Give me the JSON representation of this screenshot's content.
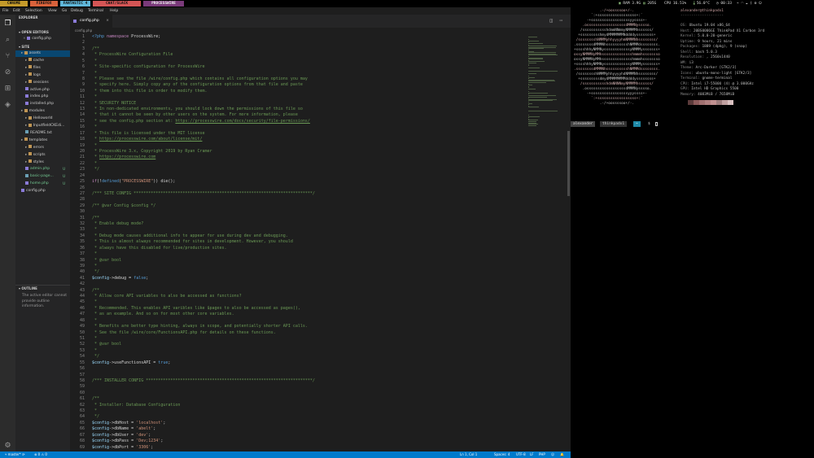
{
  "topbar": {
    "workspaces": [
      {
        "label": "CHROME",
        "color": "#c49a2a"
      },
      {
        "label": "FIREFOX",
        "color": "#d9623b"
      },
      {
        "label": "FANTASTIC 4",
        "color": "#5fb6d9"
      },
      {
        "label": "CHAT/SLACK",
        "color": "#d45555"
      },
      {
        "label": "PROCESSWIRE",
        "color": "#7a3a7a"
      }
    ],
    "ram": "RAM 3.9G",
    "cpu": "CPU 16.51%",
    "temp": "56.0°C",
    "time": "00:33",
    "disk": "205G",
    "accent_green": "#8ec07c"
  },
  "vscode": {
    "menu": [
      "File",
      "Edit",
      "Selection",
      "View",
      "Go",
      "Debug",
      "Terminal",
      "Help"
    ],
    "explorer_title": "EXPLORER",
    "open_editors_title": "OPEN EDITORS",
    "open_editor_file": "config.php",
    "site_title": "SITE",
    "tree": [
      {
        "label": "assets",
        "sel": true,
        "mark": "",
        "indent": 1
      },
      {
        "label": "cache",
        "mark": "",
        "indent": 2
      },
      {
        "label": "files",
        "mark": "",
        "indent": 2
      },
      {
        "label": "logs",
        "mark": "",
        "indent": 2
      },
      {
        "label": "sessions",
        "mark": "",
        "indent": 2
      },
      {
        "label": "active.php",
        "mark": "",
        "indent": 2
      },
      {
        "label": "index.php",
        "mark": "",
        "indent": 2
      },
      {
        "label": "installed.php",
        "mark": "",
        "indent": 2
      },
      {
        "label": "modules",
        "mark": "",
        "indent": 1
      },
      {
        "label": "Helloworld",
        "mark": "",
        "indent": 2
      },
      {
        "label": "InputfieldCKEdi...",
        "mark": "",
        "indent": 2
      },
      {
        "label": "README.txt",
        "mark": "",
        "indent": 2
      },
      {
        "label": "templates",
        "mark": "",
        "indent": 1
      },
      {
        "label": "errors",
        "mark": "",
        "indent": 2
      },
      {
        "label": "scripts",
        "mark": "",
        "indent": 2
      },
      {
        "label": "styles",
        "mark": "",
        "indent": 2
      },
      {
        "label": "admin.php",
        "mark": "U",
        "indent": 2
      },
      {
        "label": "basic-page...",
        "mark": "U",
        "indent": 2
      },
      {
        "label": "home.php",
        "mark": "U",
        "indent": 2
      },
      {
        "label": "config.php",
        "mark": "",
        "indent": 1
      }
    ],
    "outline_title": "OUTLINE",
    "outline_msg": "The active editor cannot provide outline information.",
    "tab_label": "config.php",
    "breadcrumb": "config.php",
    "code_lines": [
      {
        "n": "1",
        "parts": [
          [
            "tag",
            "<?php "
          ],
          [
            "kw",
            "namespace"
          ],
          [
            "plain",
            " ProcessWire;"
          ]
        ]
      },
      {
        "n": "2",
        "parts": []
      },
      {
        "n": "3",
        "parts": [
          [
            "comment",
            "/**"
          ]
        ]
      },
      {
        "n": "4",
        "parts": [
          [
            "comment",
            " * ProcessWire Configuration File"
          ]
        ]
      },
      {
        "n": "5",
        "parts": [
          [
            "comment",
            " *"
          ]
        ]
      },
      {
        "n": "6",
        "parts": [
          [
            "comment",
            " * Site-specific configuration for ProcessWire"
          ]
        ]
      },
      {
        "n": "7",
        "parts": [
          [
            "comment",
            " *"
          ]
        ]
      },
      {
        "n": "8",
        "parts": [
          [
            "comment",
            " * Please see the file /wire/config.php which contains all configuration options you may"
          ]
        ]
      },
      {
        "n": "9",
        "parts": [
          [
            "comment",
            " * specify here. Simply copy any of the configuration options from that file and paste"
          ]
        ]
      },
      {
        "n": "10",
        "parts": [
          [
            "comment",
            " * them into this file in order to modify them."
          ]
        ]
      },
      {
        "n": "11",
        "parts": [
          [
            "comment",
            " *"
          ]
        ]
      },
      {
        "n": "12",
        "parts": [
          [
            "comment",
            " * SECURITY NOTICE"
          ]
        ]
      },
      {
        "n": "13",
        "parts": [
          [
            "comment",
            " * In non-dedicated environments, you should lock down the permissions of this file so"
          ]
        ]
      },
      {
        "n": "14",
        "parts": [
          [
            "comment",
            " * that it cannot be seen by other users on the system. For more information, please"
          ]
        ]
      },
      {
        "n": "15",
        "parts": [
          [
            "comment",
            " * see the config.php section at: "
          ],
          [
            "link",
            "https://processwire.com/docs/security/file-permissions/"
          ]
        ]
      },
      {
        "n": "16",
        "parts": [
          [
            "comment",
            " *"
          ]
        ]
      },
      {
        "n": "17",
        "parts": [
          [
            "comment",
            " * This file is licensed under the MIT license"
          ]
        ]
      },
      {
        "n": "18",
        "parts": [
          [
            "comment",
            " * "
          ],
          [
            "link",
            "https://processwire.com/about/license/mit/"
          ]
        ]
      },
      {
        "n": "19",
        "parts": [
          [
            "comment",
            " *"
          ]
        ]
      },
      {
        "n": "20",
        "parts": [
          [
            "comment",
            " * ProcessWire 3.x, Copyright 2019 by Ryan Cramer"
          ]
        ]
      },
      {
        "n": "21",
        "parts": [
          [
            "comment",
            " * "
          ],
          [
            "link",
            "https://processwire.com"
          ]
        ]
      },
      {
        "n": "22",
        "parts": [
          [
            "comment",
            " *"
          ]
        ]
      },
      {
        "n": "23",
        "parts": [
          [
            "comment",
            " */"
          ]
        ]
      },
      {
        "n": "24",
        "parts": []
      },
      {
        "n": "25",
        "parts": [
          [
            "kw",
            "if"
          ],
          [
            "plain",
            "(!"
          ],
          [
            "tag",
            "defined"
          ],
          [
            "plain",
            "("
          ],
          [
            "str",
            "\"PROCESSWIRE\""
          ],
          [
            "plain",
            ")) die();"
          ]
        ]
      },
      {
        "n": "26",
        "parts": []
      },
      {
        "n": "27",
        "parts": [
          [
            "comment",
            "/*** SITE CONFIG *************************************************************************/"
          ]
        ]
      },
      {
        "n": "28",
        "parts": []
      },
      {
        "n": "29",
        "parts": [
          [
            "comment",
            "/** @var Config $config */"
          ]
        ]
      },
      {
        "n": "30",
        "parts": []
      },
      {
        "n": "31",
        "parts": [
          [
            "comment",
            "/**"
          ]
        ]
      },
      {
        "n": "32",
        "parts": [
          [
            "comment",
            " * Enable debug mode?"
          ]
        ]
      },
      {
        "n": "33",
        "parts": [
          [
            "comment",
            " *"
          ]
        ]
      },
      {
        "n": "34",
        "parts": [
          [
            "comment",
            " * Debug mode causes additional info to appear for use during dev and debugging."
          ]
        ]
      },
      {
        "n": "35",
        "parts": [
          [
            "comment",
            " * This is almost always recommended for sites in development. However, you should"
          ]
        ]
      },
      {
        "n": "36",
        "parts": [
          [
            "comment",
            " * always have this disabled for live/production sites."
          ]
        ]
      },
      {
        "n": "37",
        "parts": [
          [
            "comment",
            " *"
          ]
        ]
      },
      {
        "n": "38",
        "parts": [
          [
            "comment",
            " * @var bool"
          ]
        ]
      },
      {
        "n": "39",
        "parts": [
          [
            "comment",
            " *"
          ]
        ]
      },
      {
        "n": "40",
        "parts": [
          [
            "comment",
            " */"
          ]
        ]
      },
      {
        "n": "41",
        "parts": [
          [
            "var",
            "$config"
          ],
          [
            "plain",
            "->debug = "
          ],
          [
            "tag",
            "false"
          ],
          [
            "plain",
            ";"
          ]
        ]
      },
      {
        "n": "42",
        "parts": []
      },
      {
        "n": "43",
        "parts": [
          [
            "comment",
            "/**"
          ]
        ]
      },
      {
        "n": "44",
        "parts": [
          [
            "comment",
            " * Allow core API variables to also be accessed as functions?"
          ]
        ]
      },
      {
        "n": "45",
        "parts": [
          [
            "comment",
            " *"
          ]
        ]
      },
      {
        "n": "46",
        "parts": [
          [
            "comment",
            " * Recommended. This enables API varibles like $pages to also be accessed as pages(),"
          ]
        ]
      },
      {
        "n": "47",
        "parts": [
          [
            "comment",
            " * as an example. And so on for most other core variables."
          ]
        ]
      },
      {
        "n": "48",
        "parts": [
          [
            "comment",
            " *"
          ]
        ]
      },
      {
        "n": "49",
        "parts": [
          [
            "comment",
            " * Benefits are better type hinting, always in scope, and potentially shorter API calls."
          ]
        ]
      },
      {
        "n": "50",
        "parts": [
          [
            "comment",
            " * See the file /wire/core/FunctionsAPI.php for details on these functions."
          ]
        ]
      },
      {
        "n": "51",
        "parts": [
          [
            "comment",
            " *"
          ]
        ]
      },
      {
        "n": "52",
        "parts": [
          [
            "comment",
            " * @var bool"
          ]
        ]
      },
      {
        "n": "53",
        "parts": [
          [
            "comment",
            " *"
          ]
        ]
      },
      {
        "n": "54",
        "parts": [
          [
            "comment",
            " */"
          ]
        ]
      },
      {
        "n": "55",
        "parts": [
          [
            "var",
            "$config"
          ],
          [
            "plain",
            "->useFunctionsAPI = "
          ],
          [
            "tag",
            "true"
          ],
          [
            "plain",
            ";"
          ]
        ]
      },
      {
        "n": "56",
        "parts": []
      },
      {
        "n": "57",
        "parts": []
      },
      {
        "n": "58",
        "parts": [
          [
            "comment",
            "/*** INSTALLER CONFIG ********************************************************************/"
          ]
        ]
      },
      {
        "n": "59",
        "parts": []
      },
      {
        "n": "60",
        "parts": []
      },
      {
        "n": "61",
        "parts": [
          [
            "comment",
            "/**"
          ]
        ]
      },
      {
        "n": "62",
        "parts": [
          [
            "comment",
            " * Installer: Database Configuration"
          ]
        ]
      },
      {
        "n": "63",
        "parts": [
          [
            "comment",
            " *"
          ]
        ]
      },
      {
        "n": "64",
        "parts": [
          [
            "comment",
            " */"
          ]
        ]
      },
      {
        "n": "65",
        "parts": [
          [
            "var",
            "$config"
          ],
          [
            "plain",
            "->dbHost = "
          ],
          [
            "str",
            "'localhost'"
          ],
          [
            "plain",
            ";"
          ]
        ]
      },
      {
        "n": "66",
        "parts": [
          [
            "var",
            "$config"
          ],
          [
            "plain",
            "->dbName = "
          ],
          [
            "str",
            "'abelt'"
          ],
          [
            "plain",
            ";"
          ]
        ]
      },
      {
        "n": "67",
        "parts": [
          [
            "var",
            "$config"
          ],
          [
            "plain",
            "->dbUser = "
          ],
          [
            "str",
            "'dev'"
          ],
          [
            "plain",
            ";"
          ]
        ]
      },
      {
        "n": "68",
        "parts": [
          [
            "var",
            "$config"
          ],
          [
            "plain",
            "->dbPass = "
          ],
          [
            "str",
            "'Dev;1234'"
          ],
          [
            "plain",
            ";"
          ]
        ]
      },
      {
        "n": "69",
        "parts": [
          [
            "var",
            "$config"
          ],
          [
            "plain",
            "->dbPort = "
          ],
          [
            "str",
            "'3306'"
          ],
          [
            "plain",
            ";"
          ]
        ]
      }
    ],
    "status": {
      "branch": "master*",
      "sync": "⟳",
      "errors": "0",
      "warnings": "0",
      "position": "Ln 1, Col 1",
      "spaces": "Spaces: 4",
      "encoding": "UTF-8",
      "eol": "LF",
      "language": "PHP"
    }
  },
  "terminal": {
    "ascii_art": [
      "            .-/+oossssoo+/-.",
      "        `:+ssssssssssssssssss+:`",
      "      -+ssssssssssssssssssyyssss+-",
      "    .ossssssssssssssssssdMMMNysssso.",
      "   /ssssssssssshdmmNNmmyNMMMMhssssss/",
      "  +ssssssssshmydMMMMMMMNddddyssssssss+",
      " /sssssssshNMMMyhhyyyyhmNMMMNhssssssss/",
      ".ssssssssdMMMNhsssssssssshNMMMdssssssss.",
      "+sssshhhyNMMNyssssssssssssyNMMMysssssss+",
      "ossyNMMMNyMMhsssssssssssssshmmmhssssssso",
      "ossyNMMMNyMMhsssssssssssssshmmmhssssssso",
      "+sssshhhyNMMNyssssssssssssyNMMMysssssss+",
      ".ssssssssdMMMNhsssssssssshNMMMdssssssss.",
      " /sssssssshNMMMyhhyyyyhdNMMMNhssssssss/",
      "  +sssssssssdmydMMMMMMMMddddyssssssss+",
      "   /ssssssssssshdmNNNNmyNMMMMhssssss/",
      "    .ossssssssssssssssssdMMMNysssso.",
      "      -+sssssssssssssssssyyyssss+-",
      "        `:+ssssssssssssssssss+:`",
      "            .-/+oossssoo+/-."
    ],
    "user_host": "alexander@thinkpadx1",
    "separator": "--------------------",
    "info": [
      [
        "OS",
        "Ubuntu 19.04 x86_64"
      ],
      [
        "Host",
        "20BS0006GE ThinkPad X1 Carbon 3rd"
      ],
      [
        "Kernel",
        "5.0.0-20-generic"
      ],
      [
        "Uptime",
        "9 hours, 21 mins"
      ],
      [
        "Packages",
        "1889 (dpkg), 9 (snap)"
      ],
      [
        "Shell",
        "bash 5.0.3"
      ],
      [
        "Resolution",
        ", 2560x1440"
      ],
      [
        "WM",
        "i3"
      ],
      [
        "Theme",
        "Arc-Darker [GTK2/3]"
      ],
      [
        "Icons",
        "ubuntu-mono-light [GTK2/3]"
      ],
      [
        "Terminal",
        "gnome-terminal"
      ],
      [
        "CPU",
        "Intel i7-5500U (4) @ 3.000GHz"
      ],
      [
        "GPU",
        "Intel HD Graphics 5500"
      ],
      [
        "Memory",
        "4083MiB / 7658MiB"
      ]
    ],
    "palette": [
      "#5a3a3a",
      "#8c5a5a",
      "#a07070",
      "#b08080",
      "#c09090",
      "#9c7b7b",
      "#c0a0a0",
      "#d8c0c0"
    ],
    "prompt_user": "alexander",
    "prompt_host": "thinkpadx1",
    "prompt_path": "~",
    "prompt_symbol": "$"
  }
}
